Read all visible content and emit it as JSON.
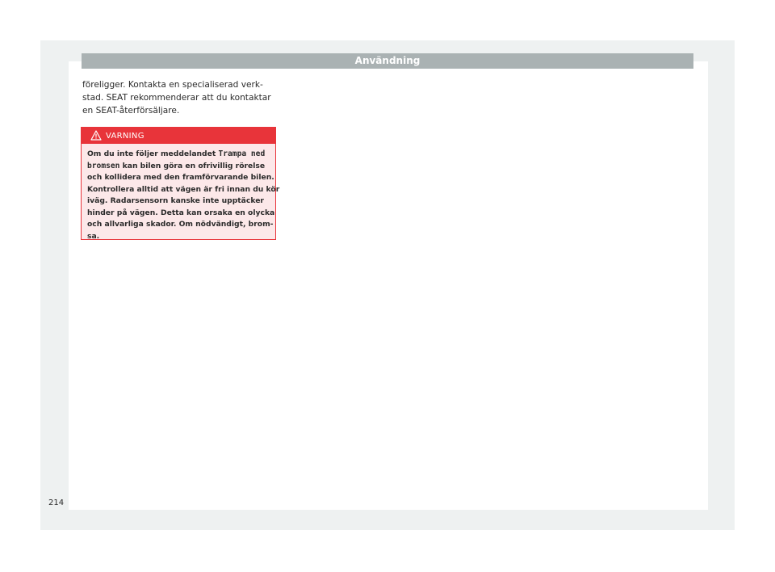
{
  "header": {
    "title": "Användning"
  },
  "body": {
    "lines": [
      "föreligger. Kontakta en specialiserad verk-",
      "stad. SEAT rekommenderar att du kontaktar",
      "en SEAT-återförsäljare."
    ]
  },
  "warning": {
    "icon": "warning-triangle-icon",
    "label": "VARNING",
    "line1_before": "Om du inte följer meddelandet ",
    "code_part1": "Trampa ned",
    "code_part2": "bromsen",
    "line2_after": " kan bilen göra en ofrivillig rörelse",
    "lines": [
      "och kollidera med den framförvarande bilen.",
      "Kontrollera alltid att vägen är fri innan du kör",
      "iväg. Radarsensorn kanske inte upptäcker",
      "hinder på vägen. Detta kan orsaka en olycka",
      "och allvarliga skador. Om nödvändigt, brom-",
      "sa."
    ]
  },
  "page_number": "214",
  "colors": {
    "header_bg": "#aab2b3",
    "warning_red": "#e8343a",
    "warning_bg": "#fce8e9",
    "outer_bg": "#eef1f1"
  }
}
